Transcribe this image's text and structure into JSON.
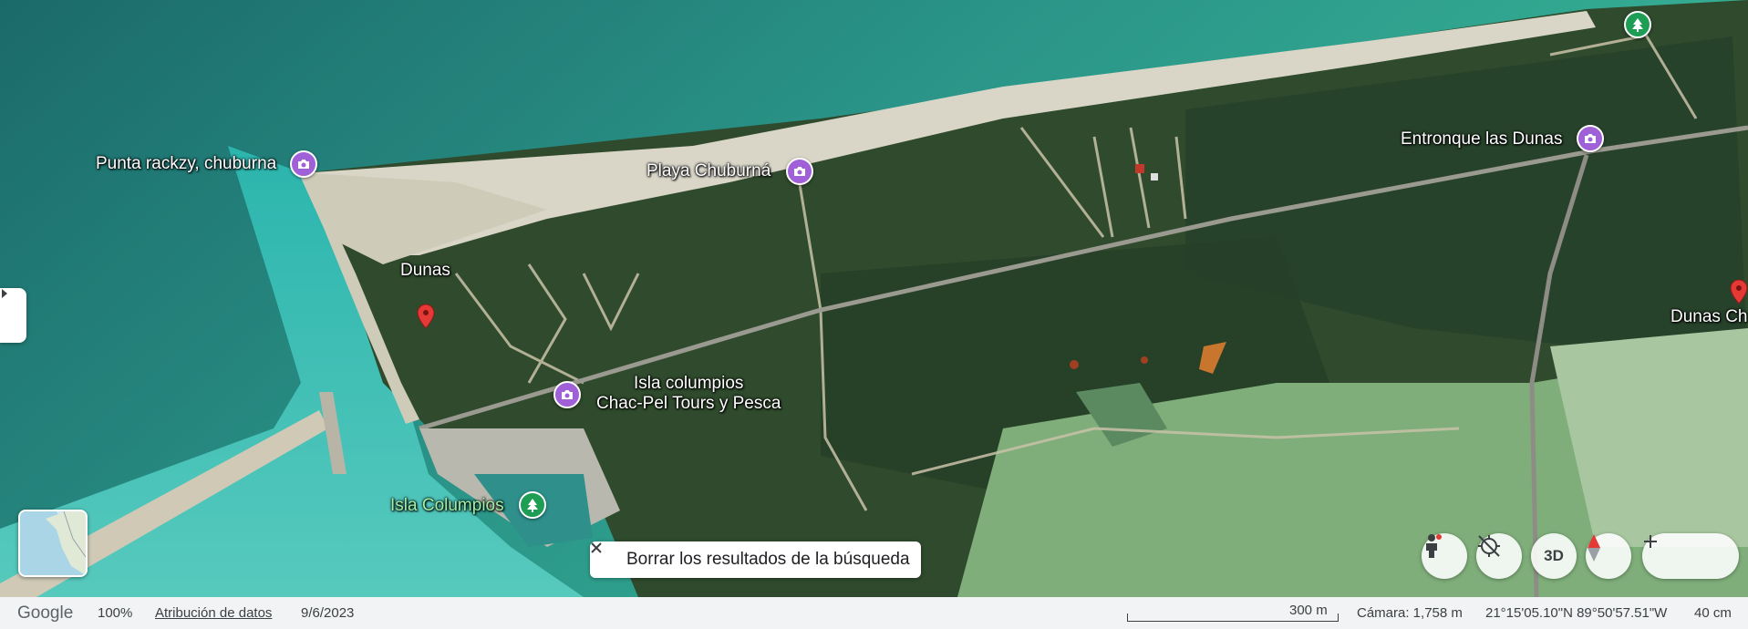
{
  "places": {
    "punta_rackzy": "Punta rackzy, chuburna",
    "playa_chuburna": "Playa Chuburná",
    "entronque": "Entronque las Dunas",
    "dunas": "Dunas",
    "isla_columpios_chacpel_line1": "Isla columpios",
    "isla_columpios_chacpel_line2": "Chac-Pel Tours y Pesca",
    "isla_columpios": "Isla Columpios",
    "dunas_ch": "Dunas Ch"
  },
  "search": {
    "clear_label": "Borrar los resultados de la búsqueda"
  },
  "controls": {
    "view_3d_label": "3D"
  },
  "footer": {
    "logo": "Google",
    "zoom": "100%",
    "attribution": "Atribución de datos",
    "date": "9/6/2023",
    "scale": "300 m",
    "camera": "Cámara: 1,758 m",
    "coordinates": "21°15'05.10\"N 89°50'57.51\"W",
    "altitude": "40 cm"
  },
  "colors": {
    "camera_pin": "#a060d8",
    "park_pin": "#1e9e55",
    "red_pin": "#e53935"
  }
}
